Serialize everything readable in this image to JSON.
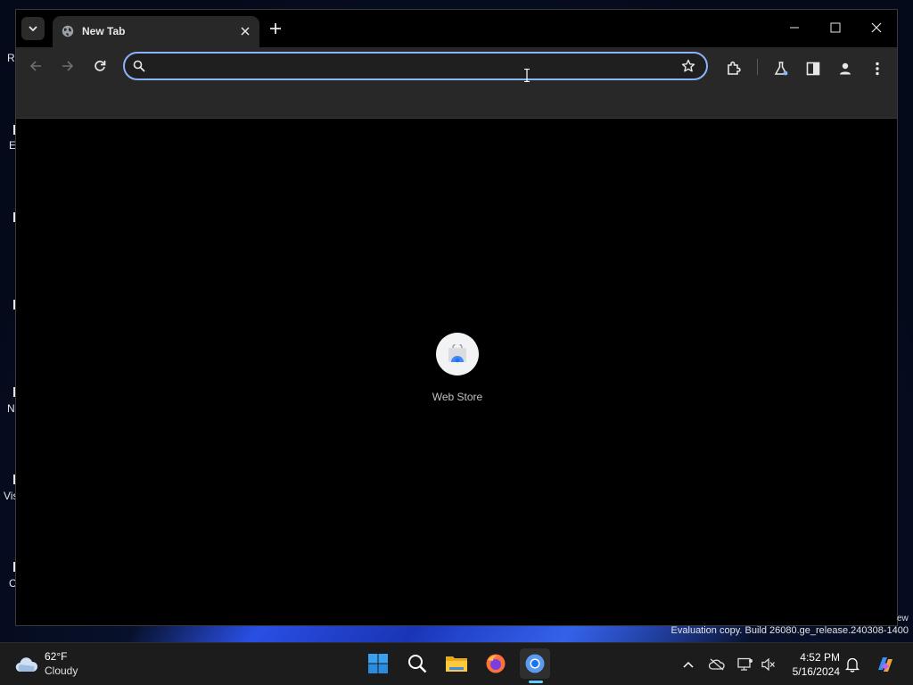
{
  "desktop": {
    "fragments": [
      "R",
      "E",
      "N",
      "Vis",
      "C"
    ]
  },
  "browser": {
    "tab": {
      "title": "New Tab"
    },
    "omnibox": {
      "value": "",
      "placeholder": ""
    },
    "shortcuts": [
      {
        "label": "Web Store"
      }
    ],
    "accent_color": "#8ab4f8"
  },
  "watermark": {
    "text": "Evaluation copy. Build 26080.ge_release.240308-1400",
    "fragment": "ew"
  },
  "taskbar": {
    "weather": {
      "temp": "62°F",
      "condition": "Cloudy"
    },
    "apps": [
      "start-icon",
      "search-icon",
      "file-explorer-icon",
      "firefox-icon",
      "chrome-icon"
    ],
    "clock": {
      "time": "4:52 PM",
      "date": "5/16/2024"
    },
    "accent_color": "#60cdff"
  }
}
